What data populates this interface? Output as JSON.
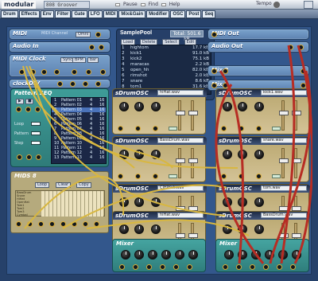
{
  "app": {
    "logo": "modular",
    "title": "808 Groover",
    "tools": [
      "Pause",
      "Find",
      "Help"
    ],
    "right_label": "Tempo"
  },
  "menu": [
    "Drum",
    "Effects",
    "Env",
    "Filter",
    "Gate",
    "LFO",
    "MIDI",
    "Mix&Gain",
    "Modifier",
    "OSC",
    "Post",
    "Seq"
  ],
  "modules": {
    "midi": {
      "name": "MIDI",
      "hint": "MIDI Channel",
      "value": "Omni"
    },
    "audio_in": {
      "name": "Audio In"
    },
    "midi_clock": {
      "name": "MIDI Clock",
      "labels": [
        "Sync",
        "BPM",
        "bar"
      ]
    },
    "clockdiv": {
      "name": "clockDIV"
    },
    "midi_out": {
      "name": "MIDI Out"
    },
    "audio_out": {
      "name": "Audio Out"
    },
    "mix2a": {
      "name": "Mix 2"
    },
    "mix2b": {
      "name": "Mix 2"
    }
  },
  "sample_pool": {
    "title": "SamplePool",
    "total": "Total: 501.6 kB",
    "tools": [
      "Load",
      "Delete",
      "Select",
      "Edit"
    ],
    "items": [
      {
        "idx": "1",
        "name": "hightom",
        "size": "17.7 kB"
      },
      {
        "idx": "2",
        "name": "kick1",
        "size": "91.0 kB"
      },
      {
        "idx": "3",
        "name": "kick2",
        "size": "75.1 kB"
      },
      {
        "idx": "4",
        "name": "maracas",
        "size": "2.2 kB"
      },
      {
        "idx": "5",
        "name": "open_hh",
        "size": "82.0 kB"
      },
      {
        "idx": "6",
        "name": "rimshot",
        "size": "2.0 kB"
      },
      {
        "idx": "7",
        "name": "snare",
        "size": "8.6 kB"
      },
      {
        "idx": "8",
        "name": "tom1",
        "size": "31.6 kB"
      }
    ]
  },
  "pattern_seq": {
    "title": "Pattern SEQ",
    "labels": [
      "Loop",
      "Pattern",
      "Step"
    ],
    "patterns": [
      {
        "n": "1",
        "name": "Pattern 01",
        "a": "4",
        "b": "16"
      },
      {
        "n": "2",
        "name": "Pattern 02",
        "a": "4",
        "b": "16"
      },
      {
        "n": "3",
        "name": "Pattern 03",
        "a": "4",
        "b": "16"
      },
      {
        "n": "4",
        "name": "Pattern 04",
        "a": "4",
        "b": "16"
      },
      {
        "n": "5",
        "name": "Pattern 05",
        "a": "4",
        "b": "16"
      },
      {
        "n": "6",
        "name": "Pattern 06",
        "a": "4",
        "b": "16"
      },
      {
        "n": "7",
        "name": "Pattern 07",
        "a": "4",
        "b": "16"
      },
      {
        "n": "8",
        "name": "Pattern 08",
        "a": "4",
        "b": "16"
      },
      {
        "n": "9",
        "name": "Pattern 09",
        "a": "4",
        "b": "16"
      },
      {
        "n": "10",
        "name": "Pattern 10",
        "a": "4",
        "b": "16"
      },
      {
        "n": "11",
        "name": "Pattern 11",
        "a": "4",
        "b": "16"
      },
      {
        "n": "12",
        "name": "Pattern 12",
        "a": "4",
        "b": "16"
      },
      {
        "n": "13",
        "name": "Pattern 13",
        "a": "4",
        "b": "16"
      }
    ]
  },
  "mids_seq": {
    "title": "MIDS 8",
    "labels": [
      "Loop",
      "Clear",
      "Copy"
    ],
    "rows": [
      "BassDrum",
      "Snare",
      "HiHat",
      "OpenHat",
      "Tom1",
      "Tom2",
      "Tom3",
      "Cymbal"
    ]
  },
  "drum_oscs": [
    {
      "title": "sDrumOSC",
      "sample": "hiHat.wav"
    },
    {
      "title": "sDrumOSC",
      "sample": "kick1.wav"
    },
    {
      "title": "sDrumOSC",
      "sample": "BassDrum.wav"
    },
    {
      "title": "sDrumOSC",
      "sample": "snare.wav"
    },
    {
      "title": "sDrumOSC",
      "sample": "ClHiHat.wav"
    },
    {
      "title": "sDrumOSC",
      "sample": "tom.wav"
    },
    {
      "title": "sDrumOSC",
      "sample": "hiHat.wav"
    },
    {
      "title": "sDrumOSC",
      "sample": "BassDrum.wav"
    }
  ],
  "mixers": [
    {
      "title": "Mixer",
      "label": "Mixer"
    },
    {
      "title": "Mixer",
      "label": "Mixer"
    }
  ],
  "colors": {
    "rack": "#33578c",
    "drum": "#c8b784",
    "teal": "#3e9c98",
    "cable_yellow": "#d8b740",
    "cable_red": "#b72d24"
  }
}
